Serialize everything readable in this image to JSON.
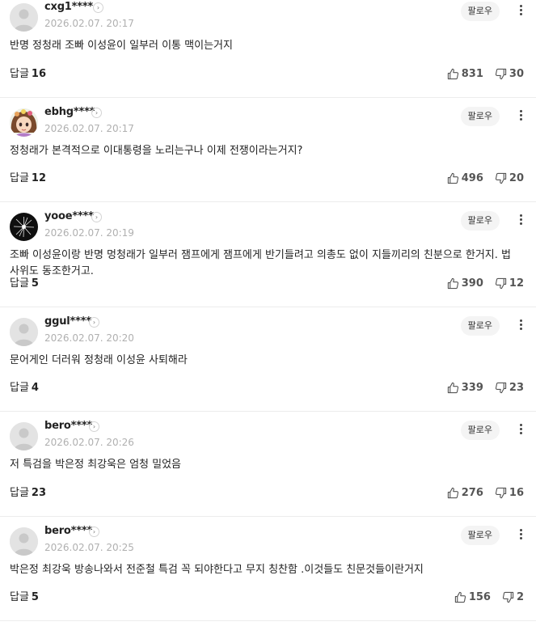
{
  "labels": {
    "follow": "팔로우",
    "reply": "답글"
  },
  "comments": [
    {
      "username": "cxg1****",
      "timestamp": "2026.02.07. 20:17",
      "text": "반명 정청래 조빠 이성윤이 일부러 이통 맥이는거지",
      "replies": "16",
      "likes": "831",
      "dislikes": "30",
      "avatar": "default-avatar-icon"
    },
    {
      "username": "ebhg****",
      "timestamp": "2026.02.07. 20:17",
      "text": "정청래가 본격적으로 이대통령을 노리는구나 이제 전쟁이라는거지?",
      "replies": "12",
      "likes": "496",
      "dislikes": "20",
      "avatar": "cartoon-girl-avatar"
    },
    {
      "username": "yooe****",
      "timestamp": "2026.02.07. 20:19",
      "text": "조빠 이성윤이랑 반명 멍청래가 일부러 잼프에게 잼프에게 반기들려고 의총도 없이 지들끼리의 친분으로 한거지. 법사위도 동조한거고.",
      "replies": "5",
      "likes": "390",
      "dislikes": "12",
      "avatar": "dandelion-avatar"
    },
    {
      "username": "ggul****",
      "timestamp": "2026.02.07. 20:20",
      "text": "문어게인 더러워 정청래 이성윤 사퇴해라",
      "replies": "4",
      "likes": "339",
      "dislikes": "23",
      "avatar": "default-avatar-icon"
    },
    {
      "username": "bero****",
      "timestamp": "2026.02.07. 20:26",
      "text": "저 특검을 박은정 최강욱은 엄청 밀었음",
      "replies": "23",
      "likes": "276",
      "dislikes": "16",
      "avatar": "default-avatar-icon"
    },
    {
      "username": "bero****",
      "timestamp": "2026.02.07. 20:25",
      "text": "박은정 최강욱 방송나와서 전준철 특검 꼭 되야한다고 무지 칭찬함 .이것들도 친문것들이란거지",
      "replies": "5",
      "likes": "156",
      "dislikes": "2",
      "avatar": "default-avatar-icon"
    }
  ]
}
